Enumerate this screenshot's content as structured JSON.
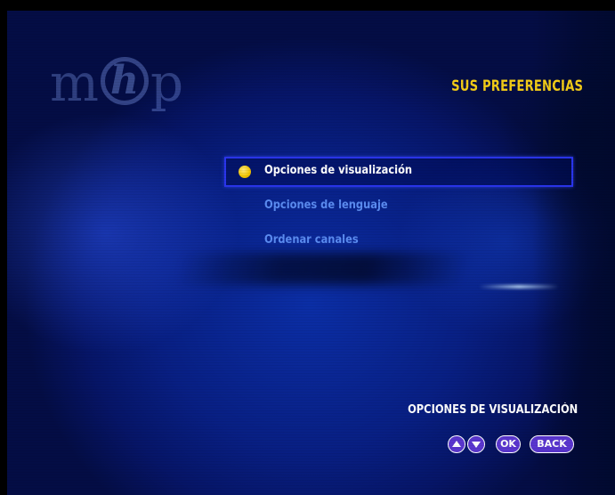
{
  "logo": {
    "text_left": "m",
    "text_center": "h",
    "text_right": "p"
  },
  "header": {
    "title": "SUS PREFERENCIAS"
  },
  "menu": {
    "items": [
      {
        "label": "Opciones de visualización",
        "selected": true
      },
      {
        "label": "Opciones de lenguaje",
        "selected": false
      },
      {
        "label": "Ordenar canales",
        "selected": false
      }
    ]
  },
  "footer": {
    "section_label": "OPCIONES DE VISUALIZACIÓN",
    "keys": {
      "up_icon": "triangle-up-icon",
      "down_icon": "triangle-down-icon",
      "ok_label": "OK",
      "back_label": "BACK"
    }
  },
  "colors": {
    "title": "#f3cc18",
    "selected_text": "#ffffff",
    "unselected_text": "#5b8cf2",
    "highlight_border": "#2a35ee",
    "bullet": "#f2c400",
    "key_fill": "#5a36cf"
  }
}
